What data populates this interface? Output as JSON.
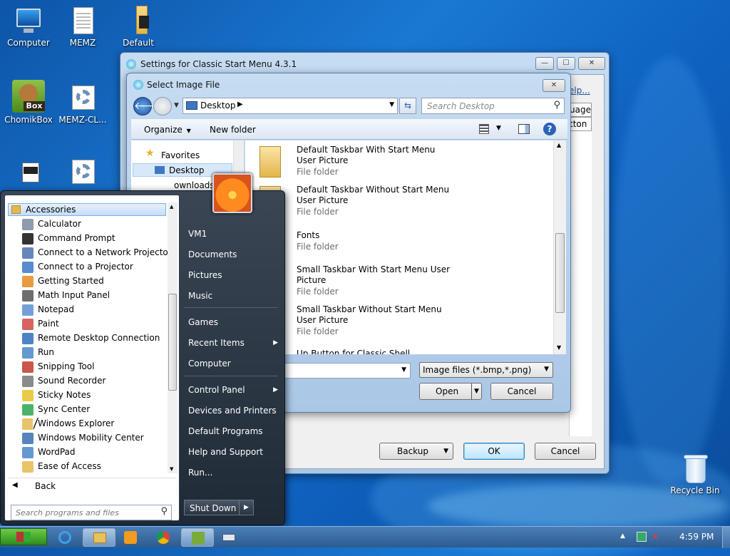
{
  "desktop": {
    "icons": [
      {
        "label": "Computer"
      },
      {
        "label": "MEMZ"
      },
      {
        "label": "Default"
      },
      {
        "label": "ChomikBox"
      },
      {
        "label": "MEMZ-CL..."
      },
      {
        "label": "Recycle Bin"
      }
    ]
  },
  "settings_window": {
    "title": "Settings for Classic Start Menu 4.3.1",
    "help_link": "elp...",
    "tab_partial_1": "uage",
    "tab_partial_2": "tton",
    "backup_label": "Backup",
    "ok_label": "OK",
    "cancel_label": "Cancel"
  },
  "file_dialog": {
    "title": "Select Image File",
    "address": "Desktop",
    "search_placeholder": "Search Desktop",
    "organize_label": "Organize",
    "new_folder_label": "New folder",
    "nav": {
      "favorites": "Favorites",
      "desktop": "Desktop",
      "downloads": "ownloads"
    },
    "files": [
      {
        "name_line1": "Default Taskbar With Start Menu",
        "name_line2": "User Picture",
        "type": "File folder"
      },
      {
        "name_line1": "Default Taskbar Without Start Menu",
        "name_line2": "User Picture",
        "type": "File folder"
      },
      {
        "name_line1": "Fonts",
        "name_line2": "",
        "type": "File folder"
      },
      {
        "name_line1": "Small Taskbar With Start Menu User",
        "name_line2": "Picture",
        "type": "File folder"
      },
      {
        "name_line1": "Small Taskbar Without Start Menu",
        "name_line2": "User Picture",
        "type": "File folder"
      },
      {
        "name_line1": "Up Button for Classic Shell",
        "name_line2": "",
        "type": ""
      }
    ],
    "file_type": "Image files (*.bmp,*.png)",
    "open_label": "Open",
    "cancel_label": "Cancel"
  },
  "start_menu": {
    "header": "Accessories",
    "programs": [
      "Calculator",
      "Command Prompt",
      "Connect to a Network Projector",
      "Connect to a Projector",
      "Getting Started",
      "Math Input Panel",
      "Notepad",
      "Paint",
      "Remote Desktop Connection",
      "Run",
      "Snipping Tool",
      "Sound Recorder",
      "Sticky Notes",
      "Sync Center",
      "Windows Explorer",
      "Windows Mobility Center",
      "WordPad",
      "Ease of Access"
    ],
    "back_label": "Back",
    "search_placeholder": "Search programs and files",
    "right_items": [
      "VM1",
      "Documents",
      "Pictures",
      "Music",
      "Games",
      "Recent Items",
      "Computer",
      "Control Panel",
      "Devices and Printers",
      "Default Programs",
      "Help and Support",
      "Run..."
    ],
    "shutdown_label": "Shut Down"
  },
  "taskbar": {
    "clock": "4:59 PM"
  }
}
